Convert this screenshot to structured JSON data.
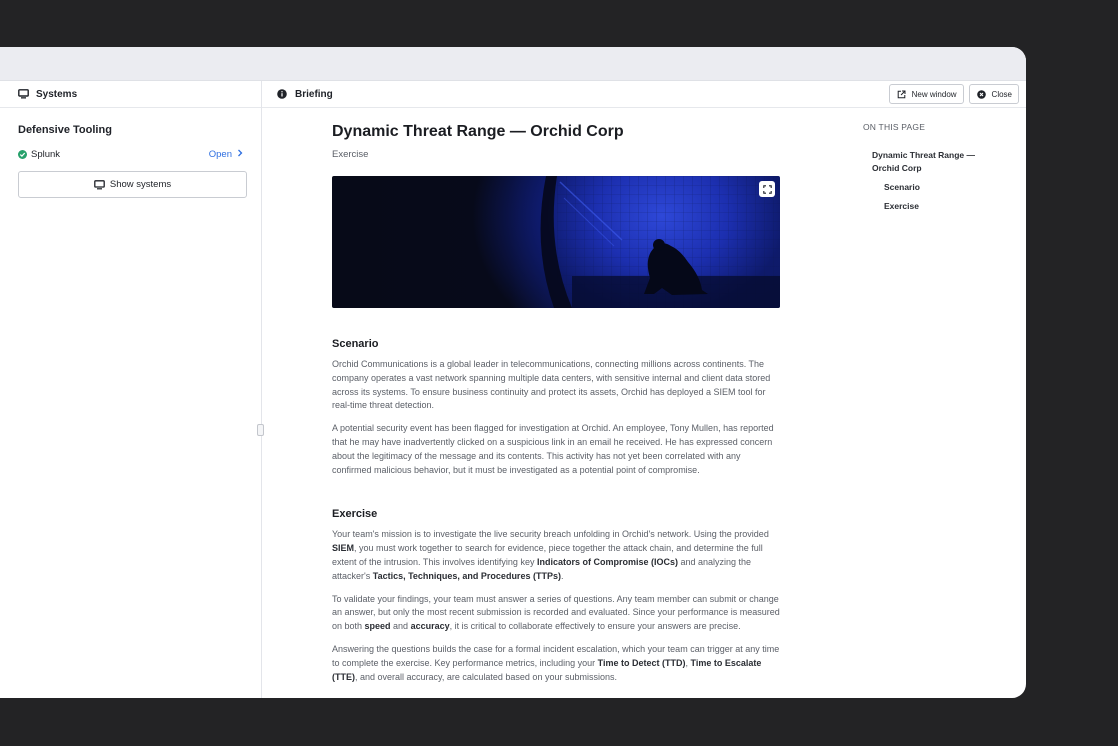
{
  "left_pane": {
    "header": "Systems",
    "group_title": "Defensive Tooling",
    "tools": [
      {
        "name": "Splunk",
        "status": "running",
        "action": "Open"
      }
    ],
    "show_systems_label": "Show systems"
  },
  "right_pane": {
    "header": "Briefing",
    "new_window_label": "New window",
    "close_label": "Close"
  },
  "article": {
    "title": "Dynamic Threat Range — Orchid Corp",
    "subtitle": "Exercise",
    "scenario": {
      "heading": "Scenario",
      "p1": "Orchid Communications is a global leader in telecommunications, connecting millions across continents. The company operates a vast network spanning multiple data centers, with sensitive internal and client data stored across its systems. To ensure business continuity and protect its assets, Orchid has deployed a SIEM tool for real-time threat detection.",
      "p2": "A potential security event has been flagged for investigation at Orchid. An employee, Tony Mullen, has reported that he may have inadvertently clicked on a suspicious link in an email he received. He has expressed concern about the legitimacy of the message and its contents. This activity has not yet been correlated with any confirmed malicious behavior, but it must be investigated as a potential point of compromise."
    },
    "exercise": {
      "heading": "Exercise",
      "p1_a": "Your team's mission is to investigate the live security breach unfolding in Orchid's network. Using the provided ",
      "p1_b": "SIEM",
      "p1_c": ", you must work together to search for evidence, piece together the attack chain, and determine the full extent of the intrusion. This involves identifying key ",
      "p1_d": "Indicators of Compromise (IOCs)",
      "p1_e": " and analyzing the attacker's ",
      "p1_f": "Tactics, Techniques, and Procedures (TTPs)",
      "p1_g": ".",
      "p2_a": "To validate your findings, your team must answer a series of questions. Any team member can submit or change an answer, but only the most recent submission is recorded and evaluated. Since your performance is measured on both ",
      "p2_b": "speed",
      "p2_c": " and ",
      "p2_d": "accuracy",
      "p2_e": ", it is critical to collaborate effectively to ensure your answers are precise.",
      "p3_a": "Answering the questions builds the case for a formal incident escalation, which your team can trigger at any time to complete the exercise. Key performance metrics, including your ",
      "p3_b": "Time to Detect (TTD)",
      "p3_c": ", ",
      "p3_d": "Time to Escalate (TTE)",
      "p3_e": ", and overall accuracy, are calculated based on your submissions."
    }
  },
  "toc": {
    "heading": "ON THIS PAGE",
    "items": [
      "Dynamic Threat Range — Orchid Corp",
      "Scenario",
      "Exercise"
    ]
  },
  "colors": {
    "accent": "#2f6fe0",
    "success": "#27a16b",
    "hero_blue": "#1c2fb0"
  },
  "icons": [
    "monitor-icon",
    "info-icon",
    "check-circle-icon",
    "chevron-right-icon",
    "external-link-icon",
    "close-circle-icon",
    "expand-icon"
  ]
}
